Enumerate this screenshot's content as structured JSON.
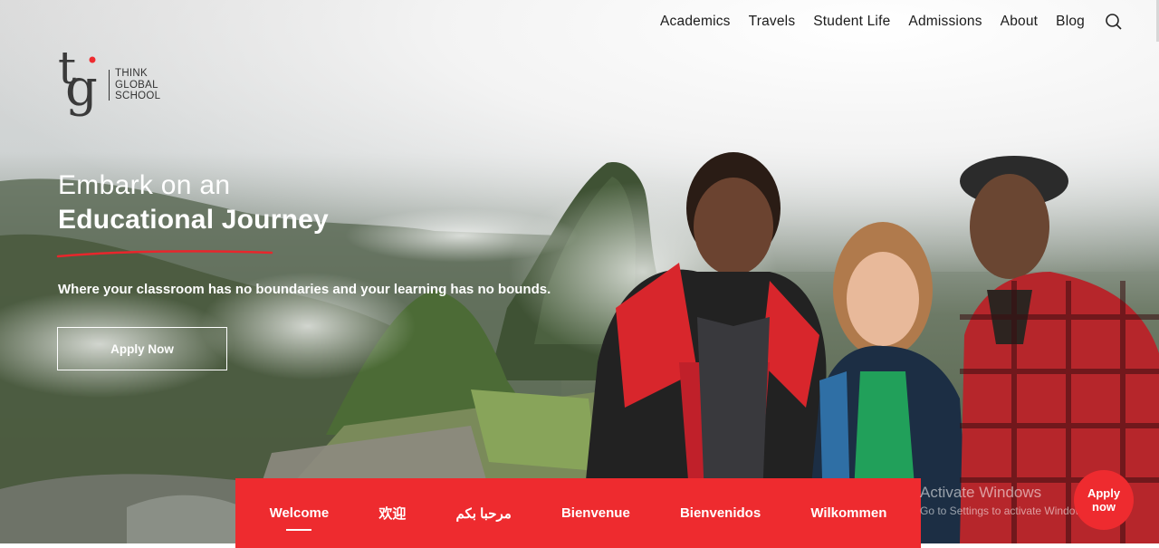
{
  "nav": {
    "items": [
      "Academics",
      "Travels",
      "Student Life",
      "Admissions",
      "About",
      "Blog"
    ],
    "search_icon": "search-icon"
  },
  "logo": {
    "mark": "tg",
    "line1": "THINK",
    "line2": "GLOBAL",
    "line3": "SCHOOL"
  },
  "hero": {
    "headline_line1": "Embark on an",
    "headline_line2": "Educational Journey",
    "tagline": "Where your classroom has no boundaries and your learning has no bounds.",
    "apply_label": "Apply Now"
  },
  "welcome_bar": {
    "items": [
      "Welcome",
      "欢迎",
      "مرحبا بكم",
      "Bienvenue",
      "Bienvenidos",
      "Wilkommen"
    ],
    "active_index": 0
  },
  "watermark": {
    "line1": "Activate Windows",
    "line2": "Go to Settings to activate Windows."
  },
  "floating_apply": {
    "line1": "Apply",
    "line2": "now"
  },
  "colors": {
    "accent": "#ee2b2f",
    "nav_text": "#1b1b1b",
    "hero_text": "#ffffff"
  }
}
